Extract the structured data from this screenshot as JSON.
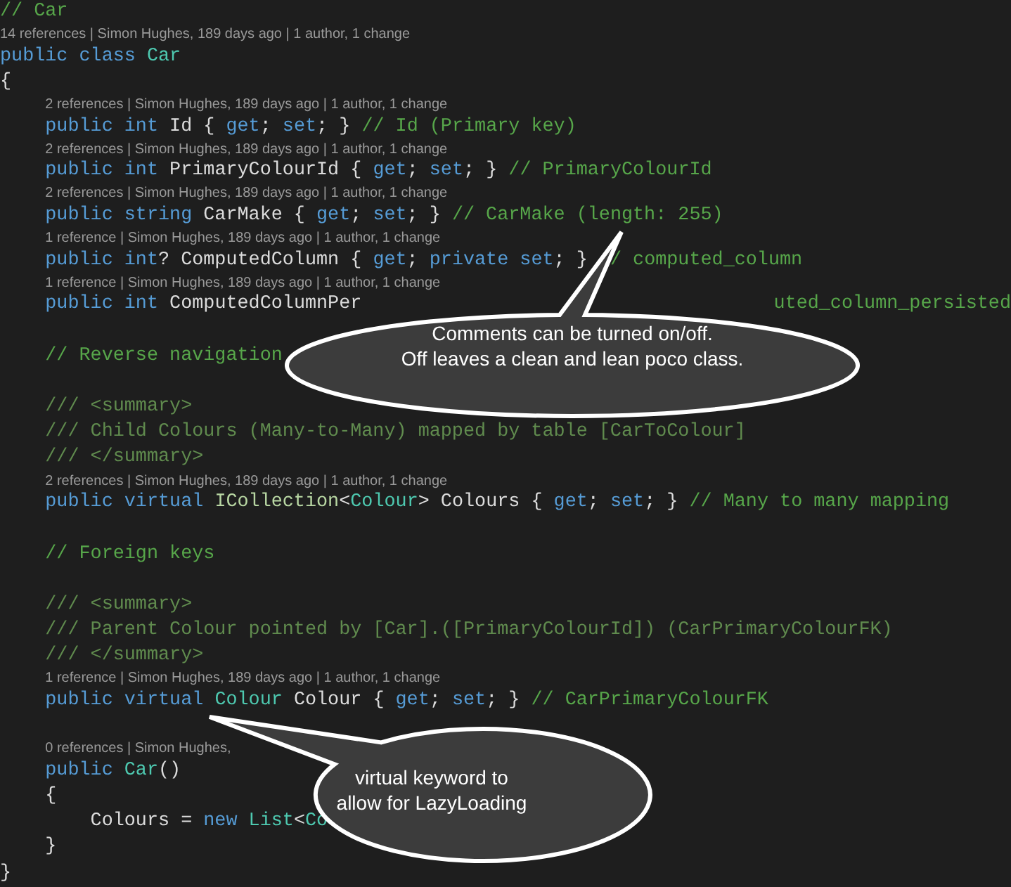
{
  "lines": [
    {
      "kind": "code",
      "tokens": [
        {
          "kind": "comment",
          "t": "// Car"
        }
      ]
    },
    {
      "kind": "lens",
      "text": "14 references | Simon Hughes, 189 days ago | 1 author, 1 change"
    },
    {
      "kind": "code",
      "tokens": [
        {
          "kind": "keyword",
          "t": "public class "
        },
        {
          "kind": "type",
          "t": "Car"
        }
      ]
    },
    {
      "kind": "code",
      "tokens": [
        {
          "kind": "plain",
          "t": "{"
        }
      ],
      "children": [
        {
          "kind": "lens",
          "text": "2 references | Simon Hughes, 189 days ago | 1 author, 1 change"
        },
        {
          "kind": "code",
          "tokens": [
            {
              "kind": "keyword",
              "t": "public int "
            },
            {
              "kind": "plain",
              "t": "Id { "
            },
            {
              "kind": "keyword",
              "t": "get"
            },
            {
              "kind": "plain",
              "t": "; "
            },
            {
              "kind": "keyword",
              "t": "set"
            },
            {
              "kind": "plain",
              "t": "; } "
            },
            {
              "kind": "comment",
              "t": "// Id (Primary key)"
            }
          ]
        },
        {
          "kind": "lens",
          "text": "2 references | Simon Hughes, 189 days ago | 1 author, 1 change"
        },
        {
          "kind": "code",
          "tokens": [
            {
              "kind": "keyword",
              "t": "public int "
            },
            {
              "kind": "plain",
              "t": "PrimaryColourId { "
            },
            {
              "kind": "keyword",
              "t": "get"
            },
            {
              "kind": "plain",
              "t": "; "
            },
            {
              "kind": "keyword",
              "t": "set"
            },
            {
              "kind": "plain",
              "t": "; } "
            },
            {
              "kind": "comment",
              "t": "// PrimaryColourId"
            }
          ]
        },
        {
          "kind": "lens",
          "text": "2 references | Simon Hughes, 189 days ago | 1 author, 1 change"
        },
        {
          "kind": "code",
          "tokens": [
            {
              "kind": "keyword",
              "t": "public string "
            },
            {
              "kind": "plain",
              "t": "CarMake { "
            },
            {
              "kind": "keyword",
              "t": "get"
            },
            {
              "kind": "plain",
              "t": "; "
            },
            {
              "kind": "keyword",
              "t": "set"
            },
            {
              "kind": "plain",
              "t": "; } "
            },
            {
              "kind": "comment",
              "t": "// CarMake (length: 255)"
            }
          ]
        },
        {
          "kind": "lens",
          "text": "1 reference | Simon Hughes, 189 days ago | 1 author, 1 change"
        },
        {
          "kind": "code",
          "tokens": [
            {
              "kind": "keyword",
              "t": "public int"
            },
            {
              "kind": "plain",
              "t": "? ComputedColumn { "
            },
            {
              "kind": "keyword",
              "t": "get"
            },
            {
              "kind": "plain",
              "t": "; "
            },
            {
              "kind": "keyword",
              "t": "private set"
            },
            {
              "kind": "plain",
              "t": "; } "
            },
            {
              "kind": "comment",
              "t": "// computed_column"
            }
          ]
        },
        {
          "kind": "lens",
          "text": "1 reference | Simon Hughes, 189 days ago | 1 author, 1 change"
        },
        {
          "kind": "code",
          "tokens": [
            {
              "kind": "keyword",
              "t": "public int "
            },
            {
              "kind": "plain",
              "t": "ComputedColumnPer"
            }
          ],
          "right_tokens": [
            {
              "kind": "comment",
              "t": "uted_column_persisted"
            }
          ]
        },
        {
          "kind": "blank"
        },
        {
          "kind": "code",
          "tokens": [
            {
              "kind": "comment",
              "t": "// Reverse navigation"
            }
          ]
        },
        {
          "kind": "blank"
        },
        {
          "kind": "code",
          "tokens": [
            {
              "kind": "doc",
              "t": "/// <summary>"
            }
          ]
        },
        {
          "kind": "code",
          "tokens": [
            {
              "kind": "doc",
              "t": "/// Child Colours (Many-to-Many) mapped by table [CarToColour]"
            }
          ]
        },
        {
          "kind": "code",
          "tokens": [
            {
              "kind": "doc",
              "t": "/// </summary>"
            }
          ]
        },
        {
          "kind": "lens",
          "text": "2 references | Simon Hughes, 189 days ago | 1 author, 1 change"
        },
        {
          "kind": "code",
          "tokens": [
            {
              "kind": "keyword",
              "t": "public virtual "
            },
            {
              "kind": "interface",
              "t": "ICollection"
            },
            {
              "kind": "plain",
              "t": "<"
            },
            {
              "kind": "type",
              "t": "Colour"
            },
            {
              "kind": "plain",
              "t": "> Colours { "
            },
            {
              "kind": "keyword",
              "t": "get"
            },
            {
              "kind": "plain",
              "t": "; "
            },
            {
              "kind": "keyword",
              "t": "set"
            },
            {
              "kind": "plain",
              "t": "; } "
            },
            {
              "kind": "comment",
              "t": "// Many to many mapping"
            }
          ]
        },
        {
          "kind": "blank"
        },
        {
          "kind": "code",
          "tokens": [
            {
              "kind": "comment",
              "t": "// Foreign keys"
            }
          ]
        },
        {
          "kind": "blank"
        },
        {
          "kind": "code",
          "tokens": [
            {
              "kind": "doc",
              "t": "/// <summary>"
            }
          ]
        },
        {
          "kind": "code",
          "tokens": [
            {
              "kind": "doc",
              "t": "/// Parent Colour pointed by [Car].([PrimaryColourId]) (CarPrimaryColourFK)"
            }
          ]
        },
        {
          "kind": "code",
          "tokens": [
            {
              "kind": "doc",
              "t": "/// </summary>"
            }
          ]
        },
        {
          "kind": "lens",
          "text": "1 reference | Simon Hughes, 189 days ago | 1 author, 1 change"
        },
        {
          "kind": "code",
          "tokens": [
            {
              "kind": "keyword",
              "t": "public virtual "
            },
            {
              "kind": "type",
              "t": "Colour"
            },
            {
              "kind": "plain",
              "t": " Colour { "
            },
            {
              "kind": "keyword",
              "t": "get"
            },
            {
              "kind": "plain",
              "t": "; "
            },
            {
              "kind": "keyword",
              "t": "set"
            },
            {
              "kind": "plain",
              "t": "; } "
            },
            {
              "kind": "comment",
              "t": "// CarPrimaryColourFK"
            }
          ]
        },
        {
          "kind": "blank"
        },
        {
          "kind": "lens",
          "text": "0 references | Simon Hughes,"
        },
        {
          "kind": "code",
          "tokens": [
            {
              "kind": "keyword",
              "t": "public "
            },
            {
              "kind": "type",
              "t": "Car"
            },
            {
              "kind": "plain",
              "t": "()"
            }
          ]
        },
        {
          "kind": "code",
          "tokens": [
            {
              "kind": "plain",
              "t": "{"
            }
          ],
          "children": [
            {
              "kind": "code",
              "tokens": [
                {
                  "kind": "plain",
                  "t": "Colours = "
                },
                {
                  "kind": "keyword",
                  "t": "new "
                },
                {
                  "kind": "type",
                  "t": "List"
                },
                {
                  "kind": "plain",
                  "t": "<"
                },
                {
                  "kind": "type",
                  "t": "Co"
                }
              ]
            }
          ]
        },
        {
          "kind": "code",
          "tokens": [
            {
              "kind": "plain",
              "t": "}"
            }
          ]
        }
      ]
    },
    {
      "kind": "code",
      "tokens": [
        {
          "kind": "plain",
          "t": "}"
        }
      ]
    }
  ],
  "callouts": [
    {
      "lines": [
        "Comments can be turned on/off.",
        "Off leaves a clean and lean poco class."
      ]
    },
    {
      "lines": [
        "virtual keyword to",
        "allow for LazyLoading"
      ]
    }
  ]
}
